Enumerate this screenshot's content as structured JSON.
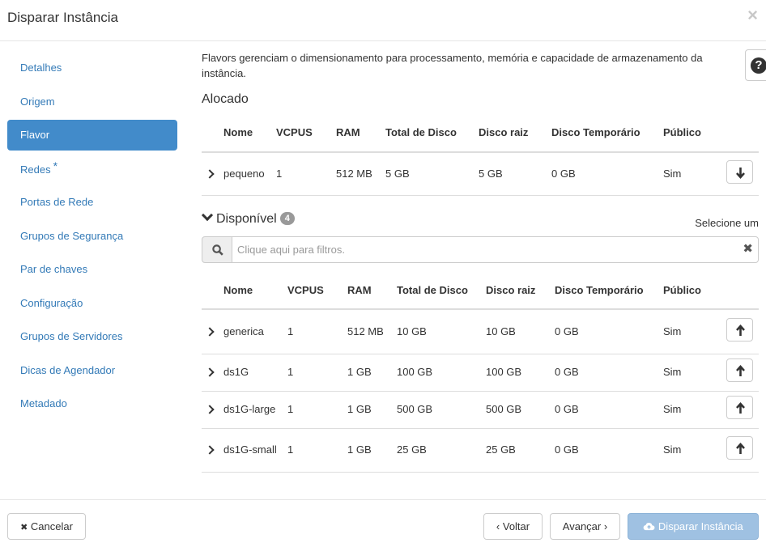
{
  "modal": {
    "title": "Disparar Instância",
    "close_glyph": "×"
  },
  "sidebar": {
    "items": [
      {
        "label": "Detalhes"
      },
      {
        "label": "Origem"
      },
      {
        "label": "Flavor"
      },
      {
        "label": "Redes",
        "required_mark": "*"
      },
      {
        "label": "Portas de Rede"
      },
      {
        "label": "Grupos de Segurança"
      },
      {
        "label": "Par de chaves"
      },
      {
        "label": "Configuração"
      },
      {
        "label": "Grupos de Servidores"
      },
      {
        "label": "Dicas de Agendador"
      },
      {
        "label": "Metadado"
      }
    ],
    "active_index": 2
  },
  "help": {
    "text": "Flavors gerenciam o dimensionamento para processamento, memória e capacidade de armazenamento da instância.",
    "icon": "question-circle-icon",
    "glyph": "?"
  },
  "allocated": {
    "title": "Alocado",
    "columns": [
      "Nome",
      "VCPUS",
      "RAM",
      "Total de Disco",
      "Disco raiz",
      "Disco Temporário",
      "Público"
    ],
    "rows": [
      {
        "name": "pequeno",
        "vcpus": "1",
        "ram": "512 MB",
        "total_disk": "5 GB",
        "root_disk": "5 GB",
        "temp_disk": "0 GB",
        "public": "Sim"
      }
    ]
  },
  "available": {
    "title": "Disponível",
    "count": "4",
    "select_one": "Selecione um",
    "search_placeholder": "Clique aqui para filtros.",
    "search_clear_glyph": "✖",
    "columns": [
      "Nome",
      "VCPUS",
      "RAM",
      "Total de Disco",
      "Disco raiz",
      "Disco Temporário",
      "Público"
    ],
    "rows": [
      {
        "name": "generica",
        "vcpus": "1",
        "ram": "512 MB",
        "total_disk": "10 GB",
        "root_disk": "10 GB",
        "temp_disk": "0 GB",
        "public": "Sim"
      },
      {
        "name": "ds1G",
        "vcpus": "1",
        "ram": "1 GB",
        "total_disk": "100 GB",
        "root_disk": "100 GB",
        "temp_disk": "0 GB",
        "public": "Sim"
      },
      {
        "name": "ds1G-large",
        "vcpus": "1",
        "ram": "1 GB",
        "total_disk": "500 GB",
        "root_disk": "500 GB",
        "temp_disk": "0 GB",
        "public": "Sim"
      },
      {
        "name": "ds1G-small",
        "vcpus": "1",
        "ram": "1 GB",
        "total_disk": "25 GB",
        "root_disk": "25 GB",
        "temp_disk": "0 GB",
        "public": "Sim"
      }
    ]
  },
  "footer": {
    "cancel_label": "Cancelar",
    "cancel_icon": "close-icon",
    "cancel_glyph": "✖",
    "back_label": "Voltar",
    "back_glyph": "‹",
    "next_label": "Avançar",
    "next_glyph": "›",
    "launch_label": "Disparar Instância",
    "launch_icon": "cloud-upload-icon"
  },
  "colors": {
    "accent": "#428bca",
    "link": "#337ab7",
    "primary_disabled": "#9fc1e2"
  }
}
